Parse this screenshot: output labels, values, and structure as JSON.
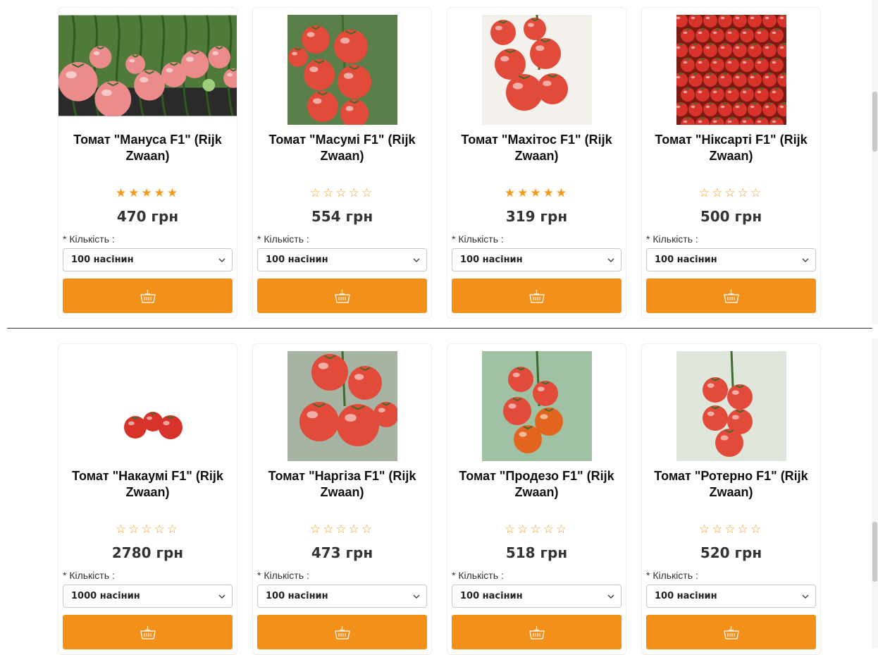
{
  "quantity_label": "* Кількість :",
  "accent_color": "#f39019",
  "star_color": "#f39a1d",
  "products": [
    {
      "title": "Томат \"Мануса F1\" (Rijk Zwaan)",
      "rating": 5,
      "price": "470 грн",
      "quantity": "100 насінин",
      "image": "tomato-pink-greenhouse-photo"
    },
    {
      "title": "Томат \"Масумі F1\" (Rijk Zwaan)",
      "rating": 0,
      "price": "554 грн",
      "quantity": "100 насінин",
      "image": "tomato-cluster-photo"
    },
    {
      "title": "Томат \"Махітос F1\" (Rijk Zwaan)",
      "rating": 5,
      "price": "319 грн",
      "quantity": "100 насінин",
      "image": "tomato-cluster-hand-photo"
    },
    {
      "title": "Томат \"Ніксарті F1\" (Rijk Zwaan)",
      "rating": 0,
      "price": "500 грн",
      "quantity": "100 насінин",
      "image": "tomato-pile-photo"
    },
    {
      "title": "Томат \"Накаумі F1\" (Rijk Zwaan)",
      "rating": 0,
      "price": "2780 грн",
      "quantity": "1000 насінин",
      "image": "tomato-three-white-photo"
    },
    {
      "title": "Томат \"Наргіза F1\" (Rijk Zwaan)",
      "rating": 0,
      "price": "473 грн",
      "quantity": "100 насінин",
      "image": "tomato-vine-large-photo"
    },
    {
      "title": "Томат \"Продезо F1\" (Rijk Zwaan)",
      "rating": 0,
      "price": "518 грн",
      "quantity": "100 насінин",
      "image": "tomato-truss-ripening-photo"
    },
    {
      "title": "Томат \"Ротерно F1\" (Rijk Zwaan)",
      "rating": 0,
      "price": "520 грн",
      "quantity": "100 насінин",
      "image": "tomato-greenhouse-truss-photo"
    }
  ]
}
